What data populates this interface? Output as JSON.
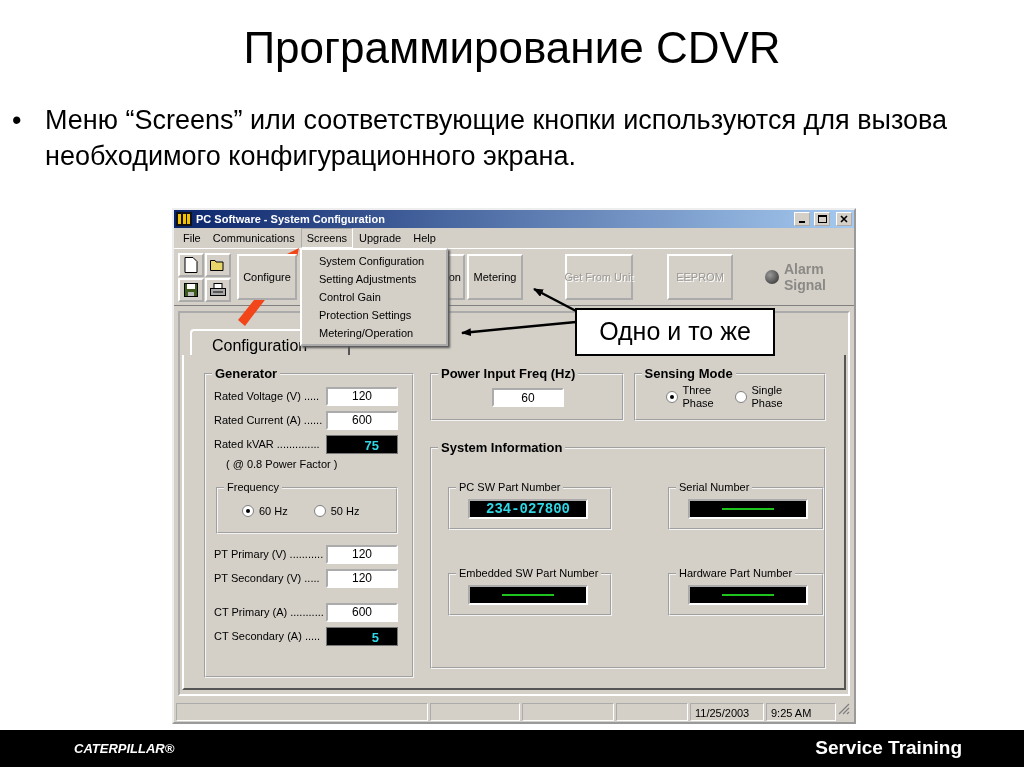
{
  "slide": {
    "title": "Программирование CDVR",
    "bullets": [
      {
        "marker": "•",
        "text": "Меню “Screens” или соответствующие кнопки используются для вызова необходимого конфигурационного экрана."
      }
    ]
  },
  "window": {
    "title": "PC Software - System Configuration"
  },
  "menu_bar": [
    {
      "label": "File",
      "selected": false
    },
    {
      "label": "Communications",
      "selected": false
    },
    {
      "label": "Screens",
      "selected": true
    },
    {
      "label": "Upgrade",
      "selected": false
    },
    {
      "label": "Help",
      "selected": false
    }
  ],
  "screens_menu": {
    "items": [
      "System Configuration",
      "Setting Adjustments",
      "Control Gain",
      "Protection Settings",
      "Metering/Operation"
    ]
  },
  "toolbar": {
    "buttons": [
      {
        "label": "Configure",
        "disabled": false
      },
      {
        "label": "on",
        "disabled": false
      },
      {
        "label": "Metering",
        "disabled": false
      },
      {
        "label": "Get From Unit",
        "disabled": true
      },
      {
        "label": "EEPROM",
        "disabled": true
      }
    ],
    "alarm": {
      "label": "Alarm Signal",
      "on": false
    }
  },
  "tabs": [
    {
      "label": "Configuration",
      "selected": true
    }
  ],
  "generator": {
    "title": "Generator",
    "fields": [
      {
        "label": "Rated Voltage (V) .....",
        "value": "120",
        "kind": "input"
      },
      {
        "label": "Rated Current (A) ......",
        "value": "600",
        "kind": "input"
      },
      {
        "label": "Rated kVAR ..............",
        "value": "75",
        "kind": "display"
      }
    ],
    "note": "( @ 0.8 Power Factor )",
    "frequency": {
      "title": "Frequency",
      "options": [
        {
          "label": "60 Hz",
          "selected": true
        },
        {
          "label": "50 Hz",
          "selected": false
        }
      ]
    },
    "pt_fields": [
      {
        "label": "PT Primary (V) ...........",
        "value": "120",
        "kind": "input"
      },
      {
        "label": "PT Secondary (V) .....",
        "value": "120",
        "kind": "input"
      }
    ],
    "ct_fields": [
      {
        "label": "CT Primary (A) ...........",
        "value": "600",
        "kind": "input"
      },
      {
        "label": "CT Secondary (A) .....",
        "value": "5",
        "kind": "display"
      }
    ]
  },
  "power_input_freq": {
    "title": "Power Input Freq (Hz)",
    "value": "60"
  },
  "sensing_mode": {
    "title": "Sensing Mode",
    "options": [
      {
        "label": "Three Phase",
        "selected": true
      },
      {
        "label": "Single Phase",
        "selected": false
      }
    ]
  },
  "system_information": {
    "title": "System Information",
    "items": [
      {
        "label": "PC SW Part Number",
        "value": "234-027800"
      },
      {
        "label": "Serial Number"
      },
      {
        "label": "Embedded SW Part Number"
      },
      {
        "label": "Hardware Part Number"
      }
    ]
  },
  "status_bar": {
    "date": "11/25/2003",
    "time": "9:25 AM"
  },
  "callout": {
    "text": "Одно и то же"
  },
  "footer": {
    "brand": "CATERPILLAR®",
    "title": "Service Training"
  }
}
